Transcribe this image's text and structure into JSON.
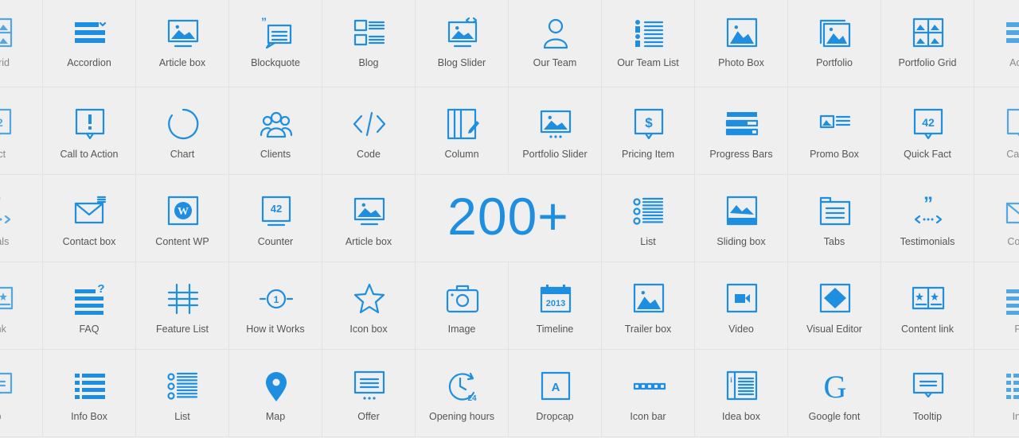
{
  "accent_color": "#1e8fe0",
  "highlight": {
    "text": "200+"
  },
  "rows": [
    [
      {
        "label": "o Grid",
        "icon": "portfolio-grid-icon"
      },
      {
        "label": "Accordion",
        "icon": "accordion-icon"
      },
      {
        "label": "Article box",
        "icon": "article-box-icon"
      },
      {
        "label": "Blockquote",
        "icon": "blockquote-icon"
      },
      {
        "label": "Blog",
        "icon": "blog-icon"
      },
      {
        "label": "Blog Slider",
        "icon": "blog-slider-icon"
      },
      {
        "label": "Our Team",
        "icon": "our-team-icon"
      },
      {
        "label": "Our Team List",
        "icon": "our-team-list-icon"
      },
      {
        "label": "Photo Box",
        "icon": "photo-box-icon"
      },
      {
        "label": "Portfolio",
        "icon": "portfolio-icon"
      },
      {
        "label": "Portfolio Grid",
        "icon": "portfolio-grid-icon"
      },
      {
        "label": "Acco",
        "icon": "accordion-icon"
      }
    ],
    [
      {
        "label": "Fact",
        "icon": "quick-fact-icon"
      },
      {
        "label": "Call to Action",
        "icon": "call-to-action-icon"
      },
      {
        "label": "Chart",
        "icon": "chart-icon"
      },
      {
        "label": "Clients",
        "icon": "clients-icon"
      },
      {
        "label": "Code",
        "icon": "code-icon"
      },
      {
        "label": "Column",
        "icon": "column-icon"
      },
      {
        "label": "Portfolio Slider",
        "icon": "portfolio-slider-icon"
      },
      {
        "label": "Pricing Item",
        "icon": "pricing-item-icon"
      },
      {
        "label": "Progress Bars",
        "icon": "progress-bars-icon"
      },
      {
        "label": "Promo Box",
        "icon": "promo-box-icon"
      },
      {
        "label": "Quick Fact",
        "icon": "quick-fact-icon"
      },
      {
        "label": "Call to",
        "icon": "call-to-action-icon"
      }
    ],
    [
      {
        "label": "onials",
        "icon": "testimonials-icon"
      },
      {
        "label": "Contact box",
        "icon": "contact-box-icon"
      },
      {
        "label": "Content WP",
        "icon": "content-wp-icon"
      },
      {
        "label": "Counter",
        "icon": "counter-icon"
      },
      {
        "label": "Article box",
        "icon": "article-box-icon"
      },
      {
        "label": "",
        "icon": ""
      },
      {
        "label": "",
        "icon": ""
      },
      {
        "label": "List",
        "icon": "list-icon"
      },
      {
        "label": "Sliding box",
        "icon": "sliding-box-icon"
      },
      {
        "label": "Tabs",
        "icon": "tabs-icon"
      },
      {
        "label": "Testimonials",
        "icon": "testimonials-icon"
      },
      {
        "label": "Conta",
        "icon": "contact-box-icon"
      }
    ],
    [
      {
        "label": "t link",
        "icon": "content-link-icon"
      },
      {
        "label": "FAQ",
        "icon": "faq-icon"
      },
      {
        "label": "Feature List",
        "icon": "feature-list-icon"
      },
      {
        "label": "How it Works",
        "icon": "how-it-works-icon"
      },
      {
        "label": "Icon box",
        "icon": "icon-box-icon"
      },
      {
        "label": "Image",
        "icon": "image-icon"
      },
      {
        "label": "Timeline",
        "icon": "timeline-icon"
      },
      {
        "label": "Trailer box",
        "icon": "trailer-box-icon"
      },
      {
        "label": "Video",
        "icon": "video-icon"
      },
      {
        "label": "Visual Editor",
        "icon": "visual-editor-icon"
      },
      {
        "label": "Content link",
        "icon": "content-link-icon"
      },
      {
        "label": "FA",
        "icon": "faq-icon"
      }
    ],
    [
      {
        "label": "tip",
        "icon": "tooltip-icon"
      },
      {
        "label": "Info Box",
        "icon": "info-box-icon"
      },
      {
        "label": "List",
        "icon": "list-icon"
      },
      {
        "label": "Map",
        "icon": "map-icon"
      },
      {
        "label": "Offer",
        "icon": "offer-icon"
      },
      {
        "label": "Opening hours",
        "icon": "opening-hours-icon"
      },
      {
        "label": "Dropcap",
        "icon": "dropcap-icon"
      },
      {
        "label": "Icon bar",
        "icon": "icon-bar-icon"
      },
      {
        "label": "Idea box",
        "icon": "idea-box-icon"
      },
      {
        "label": "Google font",
        "icon": "google-font-icon"
      },
      {
        "label": "Tooltip",
        "icon": "tooltip-icon"
      },
      {
        "label": "Info",
        "icon": "info-box-icon"
      }
    ]
  ]
}
